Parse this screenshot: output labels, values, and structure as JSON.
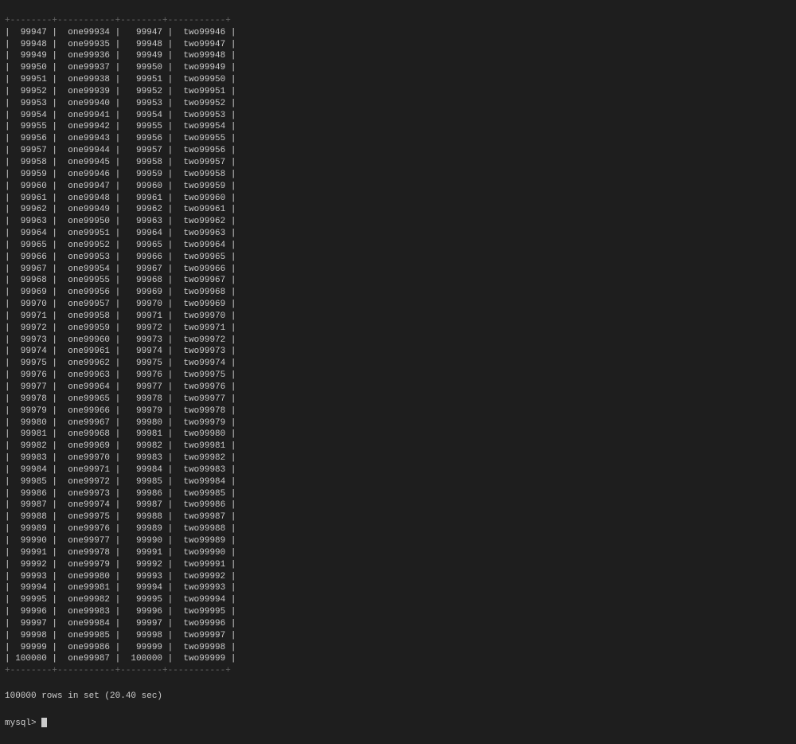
{
  "terminal": {
    "rows": [
      {
        "c1": " 99947",
        "c2": " one99934",
        "c3": "  99947",
        "c4": " two99946"
      },
      {
        "c1": " 99948",
        "c2": " one99935",
        "c3": "  99948",
        "c4": " two99947"
      },
      {
        "c1": " 99949",
        "c2": " one99936",
        "c3": "  99949",
        "c4": " two99948"
      },
      {
        "c1": " 99950",
        "c2": " one99937",
        "c3": "  99950",
        "c4": " two99949"
      },
      {
        "c1": " 99951",
        "c2": " one99938",
        "c3": "  99951",
        "c4": " two99950"
      },
      {
        "c1": " 99952",
        "c2": " one99939",
        "c3": "  99952",
        "c4": " two99951"
      },
      {
        "c1": " 99953",
        "c2": " one99940",
        "c3": "  99953",
        "c4": " two99952"
      },
      {
        "c1": " 99954",
        "c2": " one99941",
        "c3": "  99954",
        "c4": " two99953"
      },
      {
        "c1": " 99955",
        "c2": " one99942",
        "c3": "  99955",
        "c4": " two99954"
      },
      {
        "c1": " 99956",
        "c2": " one99943",
        "c3": "  99956",
        "c4": " two99955"
      },
      {
        "c1": " 99957",
        "c2": " one99944",
        "c3": "  99957",
        "c4": " two99956"
      },
      {
        "c1": " 99958",
        "c2": " one99945",
        "c3": "  99958",
        "c4": " two99957"
      },
      {
        "c1": " 99959",
        "c2": " one99946",
        "c3": "  99959",
        "c4": " two99958"
      },
      {
        "c1": " 99960",
        "c2": " one99947",
        "c3": "  99960",
        "c4": " two99959"
      },
      {
        "c1": " 99961",
        "c2": " one99948",
        "c3": "  99961",
        "c4": " two99960"
      },
      {
        "c1": " 99962",
        "c2": " one99949",
        "c3": "  99962",
        "c4": " two99961"
      },
      {
        "c1": " 99963",
        "c2": " one99950",
        "c3": "  99963",
        "c4": " two99962"
      },
      {
        "c1": " 99964",
        "c2": " one99951",
        "c3": "  99964",
        "c4": " two99963"
      },
      {
        "c1": " 99965",
        "c2": " one99952",
        "c3": "  99965",
        "c4": " two99964"
      },
      {
        "c1": " 99966",
        "c2": " one99953",
        "c3": "  99966",
        "c4": " two99965"
      },
      {
        "c1": " 99967",
        "c2": " one99954",
        "c3": "  99967",
        "c4": " two99966"
      },
      {
        "c1": " 99968",
        "c2": " one99955",
        "c3": "  99968",
        "c4": " two99967"
      },
      {
        "c1": " 99969",
        "c2": " one99956",
        "c3": "  99969",
        "c4": " two99968"
      },
      {
        "c1": " 99970",
        "c2": " one99957",
        "c3": "  99970",
        "c4": " two99969"
      },
      {
        "c1": " 99971",
        "c2": " one99958",
        "c3": "  99971",
        "c4": " two99970"
      },
      {
        "c1": " 99972",
        "c2": " one99959",
        "c3": "  99972",
        "c4": " two99971"
      },
      {
        "c1": " 99973",
        "c2": " one99960",
        "c3": "  99973",
        "c4": " two99972"
      },
      {
        "c1": " 99974",
        "c2": " one99961",
        "c3": "  99974",
        "c4": " two99973"
      },
      {
        "c1": " 99975",
        "c2": " one99962",
        "c3": "  99975",
        "c4": " two99974"
      },
      {
        "c1": " 99976",
        "c2": " one99963",
        "c3": "  99976",
        "c4": " two99975"
      },
      {
        "c1": " 99977",
        "c2": " one99964",
        "c3": "  99977",
        "c4": " two99976"
      },
      {
        "c1": " 99978",
        "c2": " one99965",
        "c3": "  99978",
        "c4": " two99977"
      },
      {
        "c1": " 99979",
        "c2": " one99966",
        "c3": "  99979",
        "c4": " two99978"
      },
      {
        "c1": " 99980",
        "c2": " one99967",
        "c3": "  99980",
        "c4": " two99979"
      },
      {
        "c1": " 99981",
        "c2": " one99968",
        "c3": "  99981",
        "c4": " two99980"
      },
      {
        "c1": " 99982",
        "c2": " one99969",
        "c3": "  99982",
        "c4": " two99981"
      },
      {
        "c1": " 99983",
        "c2": " one99970",
        "c3": "  99983",
        "c4": " two99982"
      },
      {
        "c1": " 99984",
        "c2": " one99971",
        "c3": "  99984",
        "c4": " two99983"
      },
      {
        "c1": " 99985",
        "c2": " one99972",
        "c3": "  99985",
        "c4": " two99984"
      },
      {
        "c1": " 99986",
        "c2": " one99973",
        "c3": "  99986",
        "c4": " two99985"
      },
      {
        "c1": " 99987",
        "c2": " one99974",
        "c3": "  99987",
        "c4": " two99986"
      },
      {
        "c1": " 99988",
        "c2": " one99975",
        "c3": "  99988",
        "c4": " two99987"
      },
      {
        "c1": " 99989",
        "c2": " one99976",
        "c3": "  99989",
        "c4": " two99988"
      },
      {
        "c1": " 99990",
        "c2": " one99977",
        "c3": "  99990",
        "c4": " two99989"
      },
      {
        "c1": " 99991",
        "c2": " one99978",
        "c3": "  99991",
        "c4": " two99990"
      },
      {
        "c1": " 99992",
        "c2": " one99979",
        "c3": "  99992",
        "c4": " two99991"
      },
      {
        "c1": " 99993",
        "c2": " one99980",
        "c3": "  99993",
        "c4": " two99992"
      },
      {
        "c1": " 99994",
        "c2": " one99981",
        "c3": "  99994",
        "c4": " two99993"
      },
      {
        "c1": " 99995",
        "c2": " one99982",
        "c3": "  99995",
        "c4": " two99994"
      },
      {
        "c1": " 99996",
        "c2": " one99983",
        "c3": "  99996",
        "c4": " two99995"
      },
      {
        "c1": " 99997",
        "c2": " one99984",
        "c3": "  99997",
        "c4": " two99996"
      },
      {
        "c1": " 99998",
        "c2": " one99985",
        "c3": "  99998",
        "c4": " two99997"
      },
      {
        "c1": " 99999",
        "c2": " one99986",
        "c3": "  99999",
        "c4": " two99998"
      },
      {
        "c1": "100000",
        "c2": " one99987",
        "c3": " 100000",
        "c4": " two99999"
      }
    ],
    "separator": "+--------+-----------+--------+-----------+",
    "footer": "100000 rows in set (20.40 sec)",
    "prompt": "mysql> "
  }
}
